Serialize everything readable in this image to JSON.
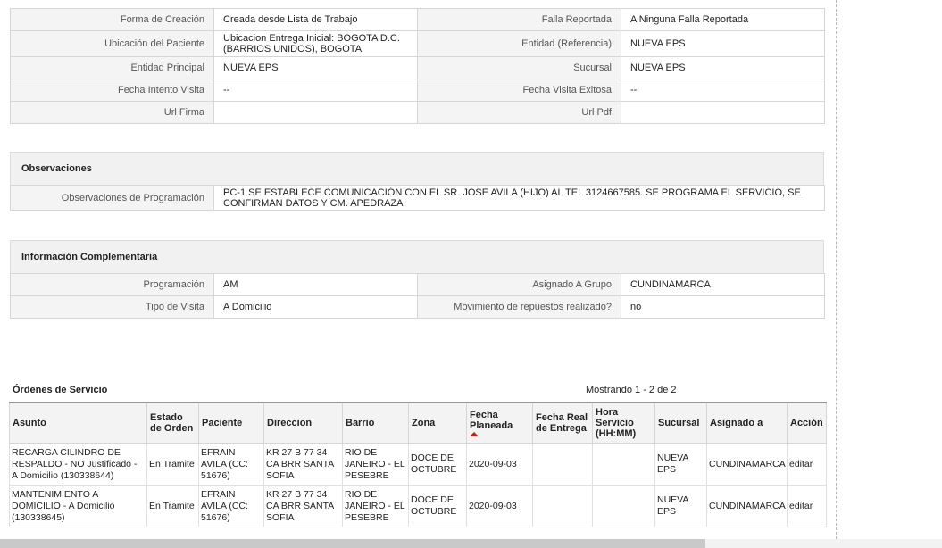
{
  "details": {
    "rows": [
      {
        "label": "Forma de Creación",
        "value": "Creada desde Lista de Trabajo",
        "label2": "Falla Reportada",
        "value2": "A Ninguna Falla Reportada"
      },
      {
        "label": "Ubicación del Paciente",
        "value": "Ubicacion Entrega Inicial: BOGOTA D.C. (BARRIOS UNIDOS), BOGOTA",
        "label2": "Entidad (Referencia)",
        "value2": "NUEVA EPS"
      },
      {
        "label": "Entidad Principal",
        "value": "NUEVA EPS",
        "label2": "Sucursal",
        "value2": "NUEVA EPS"
      },
      {
        "label": "Fecha Intento Visita",
        "value": "--",
        "label2": "Fecha Visita Exitosa",
        "value2": "--"
      },
      {
        "label": "Url Firma",
        "value": "",
        "label2": "Url Pdf",
        "value2": ""
      }
    ]
  },
  "observaciones": {
    "title": "Observaciones",
    "label": "Observaciones de Programación",
    "value": "PC-1 SE ESTABLECE COMUNICACIÓN CON EL SR. JOSE AVILA (HIJO) AL TEL 3124667585. SE PROGRAMA EL SERVICIO, SE CONFIRMAN DATOS Y CM. APEDRAZA"
  },
  "complementaria": {
    "title": "Información Complementaria",
    "rows": [
      {
        "label": "Programación",
        "value": "AM",
        "label2": "Asignado A Grupo",
        "value2": "CUNDINAMARCA"
      },
      {
        "label": "Tipo de Visita",
        "value": "A Domicilio",
        "label2": "Movimiento de repuestos realizado?",
        "value2": "no"
      }
    ]
  },
  "ordenes": {
    "title": "Órdenes de Servicio",
    "count": "Mostrando 1 - 2 de 2",
    "headers": [
      "Asunto",
      "Estado de Orden",
      "Paciente",
      "Direccion",
      "Barrio",
      "Zona",
      "Fecha Planeada",
      "Fecha Real de Entrega",
      "Hora Servicio (HH:MM)",
      "Sucursal",
      "Asignado a",
      "Acción"
    ],
    "rows": [
      {
        "asunto": "RECARGA CILINDRO DE RESPALDO - NO Justificado - A Domicilio (130338644)",
        "estado": "En Tramite",
        "paciente": "EFRAIN AVILA (CC: 51676)",
        "direccion": "KR 27 B 77 34 CA BRR SANTA SOFIA",
        "barrio": "RIO DE JANEIRO - EL PESEBRE",
        "zona": "DOCE DE OCTUBRE",
        "fecha": "2020-09-03",
        "fecha_real": "",
        "hora": "",
        "sucursal": "NUEVA EPS",
        "asignado": "CUNDINAMARCA",
        "accion": "editar"
      },
      {
        "asunto": "MANTENIMIENTO A DOMICILIO - A Domicilio (130338645)",
        "estado": "En Tramite",
        "paciente": "EFRAIN AVILA (CC: 51676)",
        "direccion": "KR 27 B 77 34 CA BRR SANTA SOFIA",
        "barrio": "RIO DE JANEIRO - EL PESEBRE",
        "zona": "DOCE DE OCTUBRE",
        "fecha": "2020-09-03",
        "fecha_real": "",
        "hora": "",
        "sucursal": "NUEVA EPS",
        "asignado": "CUNDINAMARCA",
        "accion": "editar"
      }
    ]
  }
}
